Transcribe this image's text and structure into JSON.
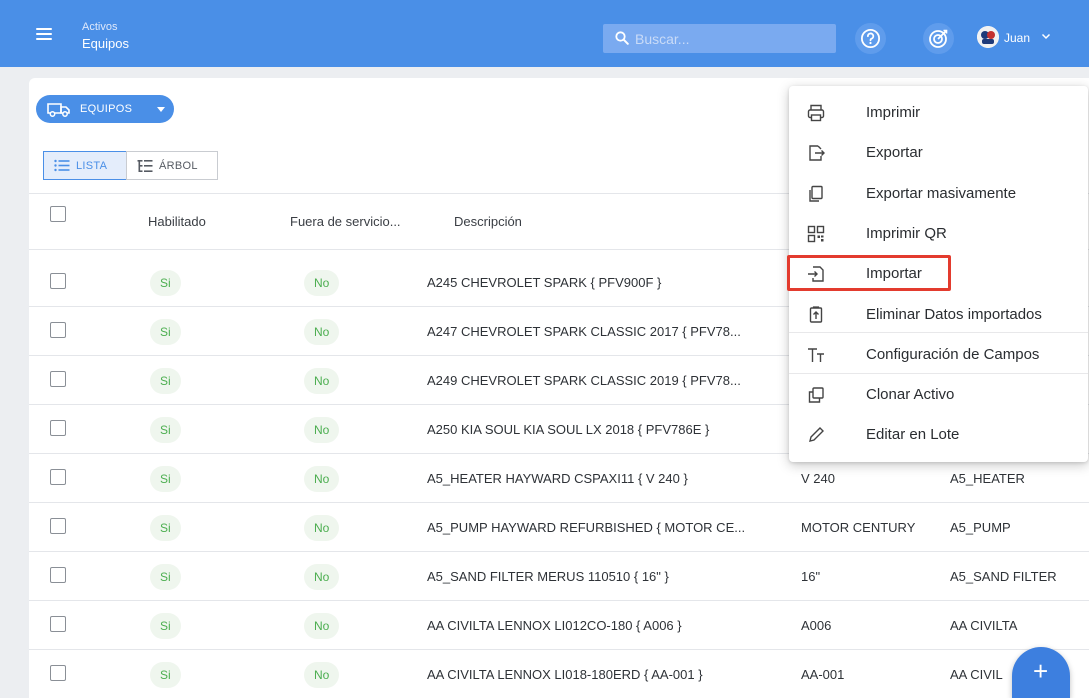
{
  "header": {
    "breadcrumb_parent": "Activos",
    "breadcrumb_current": "Equipos",
    "search_placeholder": "Buscar...",
    "user_name": "Juan",
    "primary_color": "#4a8fe7"
  },
  "toolbar": {
    "category_chip": "EQUIPOS",
    "view_tabs": [
      {
        "label": "LISTA",
        "active": true
      },
      {
        "label": "ÁRBOL",
        "active": false
      }
    ]
  },
  "table": {
    "columns": [
      "Habilitado",
      "Fuera de servicio...",
      "Descripción"
    ],
    "rows": [
      {
        "habilitado": "Si",
        "fuera_servicio": "No",
        "descripcion": "A245 CHEVROLET SPARK { PFV900F }",
        "col4": "",
        "col5": ""
      },
      {
        "habilitado": "Si",
        "fuera_servicio": "No",
        "descripcion": "A247 CHEVROLET SPARK CLASSIC 2017 { PFV78...",
        "col4": "",
        "col5": ""
      },
      {
        "habilitado": "Si",
        "fuera_servicio": "No",
        "descripcion": "A249 CHEVROLET SPARK CLASSIC 2019 { PFV78...",
        "col4": "",
        "col5": ""
      },
      {
        "habilitado": "Si",
        "fuera_servicio": "No",
        "descripcion": "A250 KIA SOUL KIA SOUL LX 2018 { PFV786E }",
        "col4": "",
        "col5": ""
      },
      {
        "habilitado": "Si",
        "fuera_servicio": "No",
        "descripcion": "A5_HEATER HAYWARD CSPAXI11 { V 240 }",
        "col4": "V 240",
        "col5": "A5_HEATER"
      },
      {
        "habilitado": "Si",
        "fuera_servicio": "No",
        "descripcion": "A5_PUMP HAYWARD REFURBISHED { MOTOR CE...",
        "col4": "MOTOR CENTURY",
        "col5": "A5_PUMP"
      },
      {
        "habilitado": "Si",
        "fuera_servicio": "No",
        "descripcion": "A5_SAND FILTER MERUS 110510 { 16\" }",
        "col4": "16\"",
        "col5": "A5_SAND FILTER"
      },
      {
        "habilitado": "Si",
        "fuera_servicio": "No",
        "descripcion": "AA CIVILTA LENNOX LI012CO-180 { A006 }",
        "col4": "A006",
        "col5": "AA CIVILTA"
      },
      {
        "habilitado": "Si",
        "fuera_servicio": "No",
        "descripcion": "AA CIVILTA LENNOX LI018-180ERD { AA-001 }",
        "col4": "AA-001",
        "col5": "AA CIVIL"
      }
    ]
  },
  "menu": {
    "items": [
      {
        "label": "Imprimir",
        "icon": "printer-icon"
      },
      {
        "label": "Exportar",
        "icon": "export-icon"
      },
      {
        "label": "Exportar masivamente",
        "icon": "bulk-export-icon"
      },
      {
        "label": "Imprimir QR",
        "icon": "qr-code-icon"
      },
      {
        "label": "Importar",
        "icon": "import-icon",
        "highlighted": true
      },
      {
        "label": "Eliminar Datos importados",
        "icon": "delete-imported-icon"
      },
      {
        "label": "Configuración de Campos",
        "icon": "text-fields-icon"
      },
      {
        "label": "Clonar Activo",
        "icon": "clone-icon"
      },
      {
        "label": "Editar en Lote",
        "icon": "pencil-icon"
      }
    ],
    "highlight_color": "#e33b2e"
  },
  "fab": {
    "label": "+"
  }
}
